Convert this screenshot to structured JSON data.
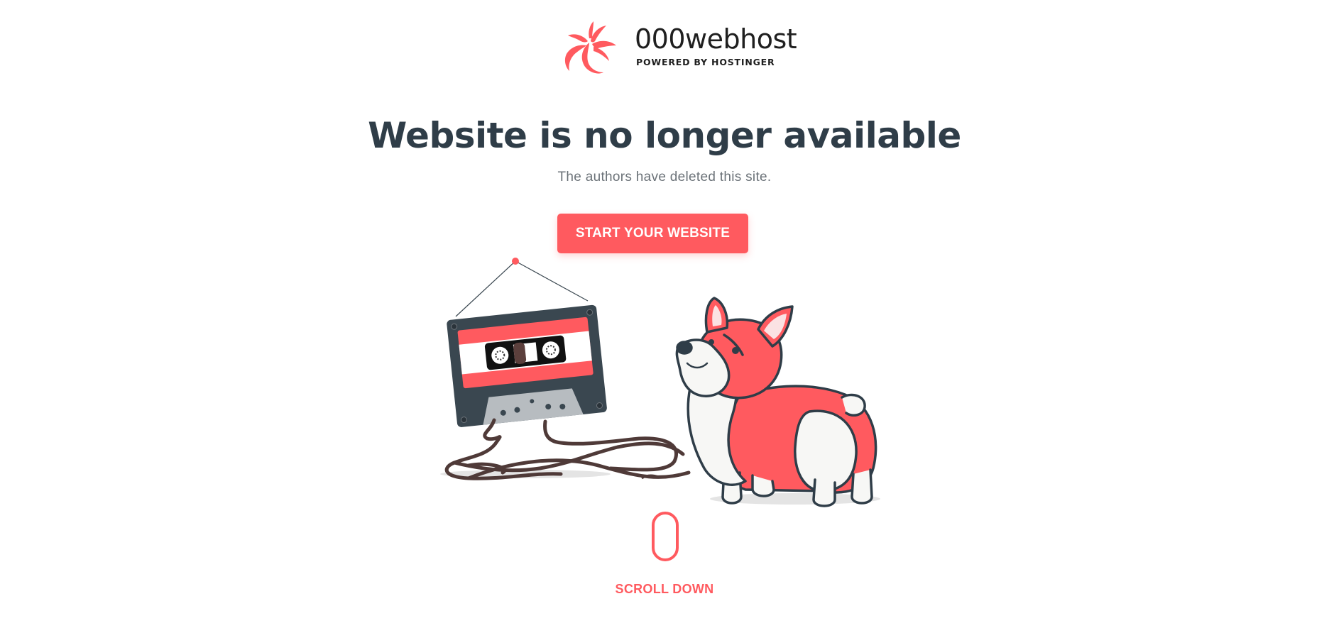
{
  "brand": {
    "name": "000webhost",
    "tagline": "POWERED BY HOSTINGER",
    "accent_color": "#ff5a5f",
    "logo_icon": "swirl-logo-icon"
  },
  "hero": {
    "title": "Website is no longer available",
    "subtitle": "The authors have deleted this site.",
    "cta_label": "START YOUR WEBSITE"
  },
  "illustration": {
    "icons": [
      "cassette-tape-icon",
      "corgi-dog-icon"
    ]
  },
  "scroll": {
    "label": "SCROLL DOWN",
    "icon": "mouse-scroll-icon"
  }
}
